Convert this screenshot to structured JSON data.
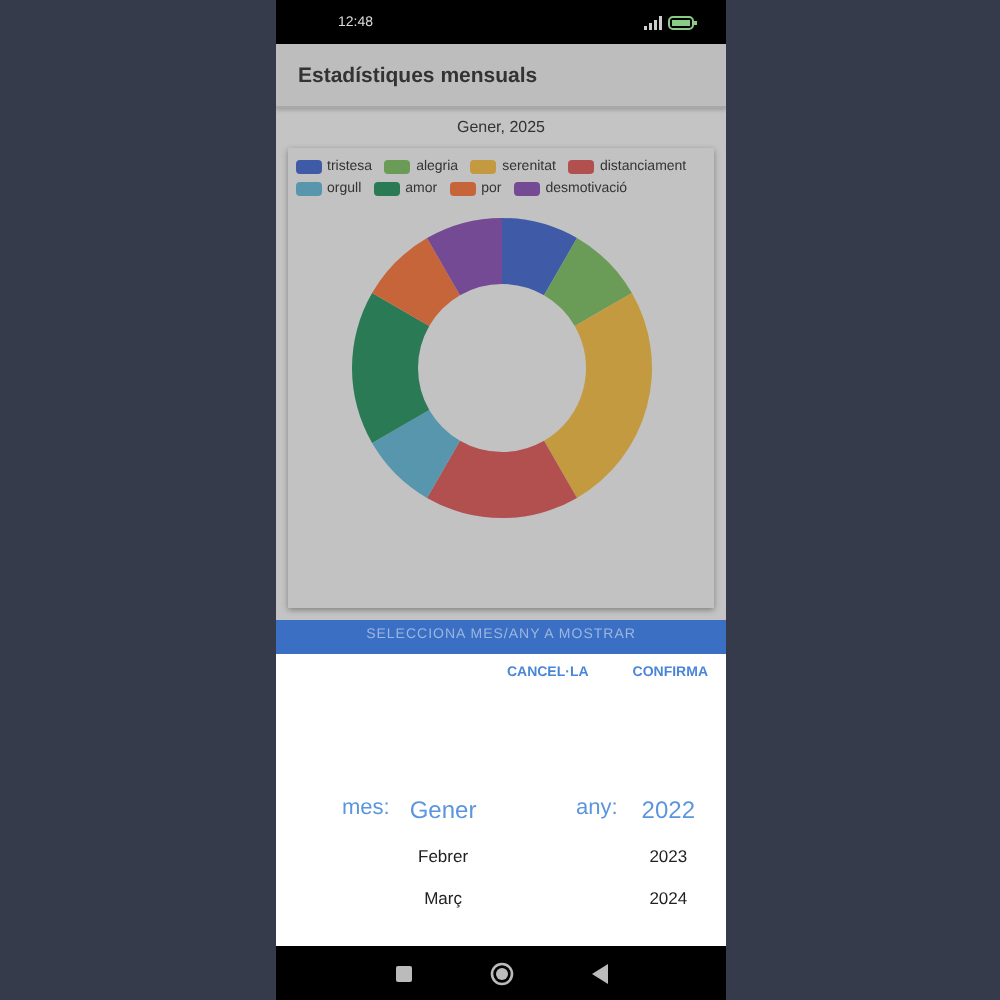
{
  "status_bar": {
    "time": "12:48"
  },
  "app_bar": {
    "title": "Estadístiques mensuals"
  },
  "period": "Gener, 2025",
  "legend": [
    {
      "label": "tristesa",
      "color": "#3f5aa6"
    },
    {
      "label": "alegria",
      "color": "#6a9c58"
    },
    {
      "label": "serenitat",
      "color": "#c39a40"
    },
    {
      "label": "distanciament",
      "color": "#b24f4f"
    },
    {
      "label": "orgull",
      "color": "#5896ae"
    },
    {
      "label": "amor",
      "color": "#2a7a55"
    },
    {
      "label": "por",
      "color": "#c6653a"
    },
    {
      "label": "desmotivació",
      "color": "#734a93"
    }
  ],
  "select_button": "SELECCIONA MES/ANY A MOSTRAR",
  "picker": {
    "actions": [
      "CANCEL·LA",
      "CONFIRMA"
    ],
    "columns": [
      {
        "label": "mes:",
        "options": [
          {
            "text": "Gener",
            "selected": true
          },
          {
            "text": "Febrer",
            "selected": false
          },
          {
            "text": "Març",
            "selected": false
          }
        ]
      },
      {
        "label": "any:",
        "options": [
          {
            "text": "2022",
            "selected": true
          },
          {
            "text": "2023",
            "selected": false
          },
          {
            "text": "2024",
            "selected": false
          }
        ]
      }
    ]
  }
}
